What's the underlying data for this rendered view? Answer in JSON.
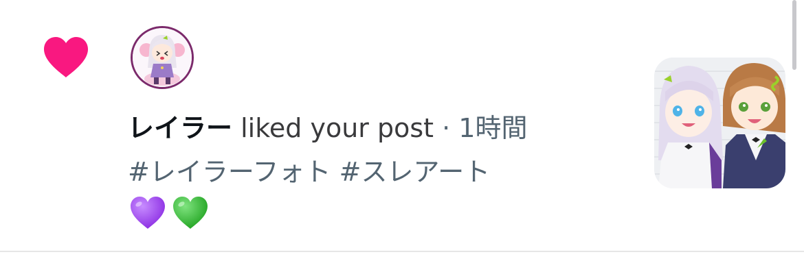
{
  "notification": {
    "type_icon": "heart-icon",
    "type_icon_color": "#f91880",
    "avatar_icon": "user-avatar",
    "username": "レイラー",
    "action": "liked your post",
    "separator": "·",
    "time": "1時間",
    "hashtags": [
      "#レイラーフォト",
      "#スレアート"
    ],
    "emojis": [
      {
        "name": "purple-heart-icon",
        "color": "#9b3cf0"
      },
      {
        "name": "green-heart-icon",
        "color": "#2fc12f"
      }
    ],
    "post_thumbnail": "post-image"
  },
  "colors": {
    "primary_text": "#0f1419",
    "secondary_text": "#536471",
    "divider": "#e6e6e6"
  }
}
